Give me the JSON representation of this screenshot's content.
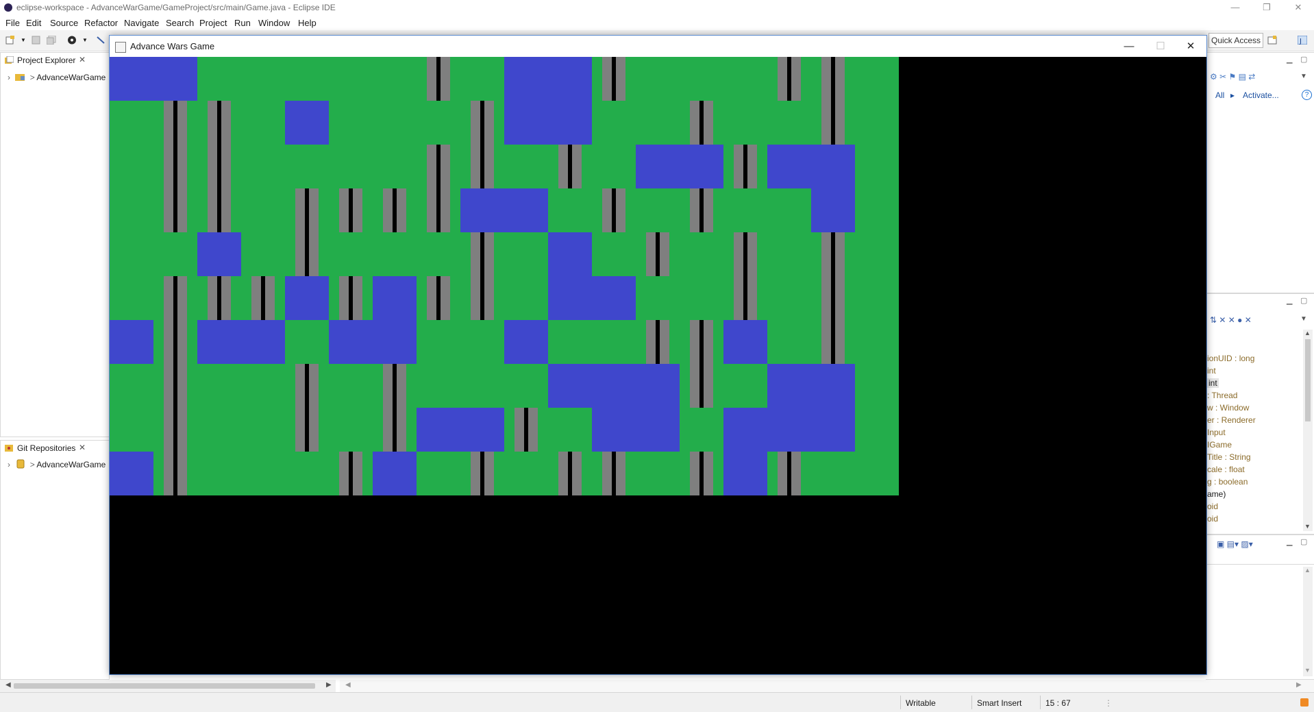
{
  "ide": {
    "window_title": "eclipse-workspace - AdvanceWarGame/GameProject/src/main/Game.java - Eclipse IDE",
    "window_controls": {
      "minimize": "—",
      "restore": "❐",
      "close": "✕"
    },
    "menu": [
      "File",
      "Edit",
      "Source",
      "Refactor",
      "Navigate",
      "Search",
      "Project",
      "Run",
      "Window",
      "Help"
    ],
    "quick_access": "Quick Access",
    "project_explorer": {
      "title": "Project Explorer",
      "close_glyph": "✕",
      "items": [
        {
          "label": "AdvanceWarGame",
          "prefix": ">"
        }
      ]
    },
    "git_repositories": {
      "title": "Git Repositories",
      "close_glyph": "✕",
      "items": [
        {
          "label": "AdvanceWarGame",
          "prefix": ">"
        }
      ]
    },
    "tasks_toolbar": {
      "all": "All",
      "activate": "Activate..."
    },
    "outline": {
      "items": [
        {
          "name": "ionUID",
          "type": " : long"
        },
        {
          "name": "int",
          "type": ""
        },
        {
          "name": "int",
          "type": "",
          "selected": true
        },
        {
          "name": "",
          "type": ": Thread"
        },
        {
          "name": "w",
          "type": " : Window"
        },
        {
          "name": "er",
          "type": " : Renderer"
        },
        {
          "name": "Input",
          "type": ""
        },
        {
          "name": "IGame",
          "type": ""
        },
        {
          "name": "Title",
          "type": " : String"
        },
        {
          "name": "cale",
          "type": " : float"
        },
        {
          "name": "g",
          "type": " : boolean"
        },
        {
          "name": "ame)",
          "type": ""
        },
        {
          "name": "oid",
          "type": ""
        },
        {
          "name": "oid",
          "type": ""
        }
      ]
    },
    "status": {
      "writable": "Writable",
      "insert_mode": "Smart Insert",
      "position": "15 : 67"
    }
  },
  "game_window": {
    "title": "Advance Wars Game",
    "controls": {
      "minimize": "—",
      "maximize": "☐",
      "close": "✕"
    }
  },
  "map": {
    "legend": {
      "G": "grass",
      "W": "water",
      "R": "road"
    },
    "colors": {
      "grass": "#23ad4b",
      "water": "#3f47cc",
      "road": "#7f7f7f",
      "road_line": "#000000",
      "background": "#000000"
    },
    "rows": [
      "WWGGGGGRGWWRGGGRRG",
      "GRRGWGGGRWWGGRGGRG",
      "GRRGGGGRRGRGWWRWWG",
      "GRRGRRRRWWGRGRGGWG",
      "GGWGRGGGRGWGRGRGRG",
      "GRRRWRWRRGWWGGRGRG",
      "WRWWGWWGGWGGRRWGRG",
      "GRGGRGRGGGWWWRGWWG",
      "GRGGRGRWWRGWWGWWWG",
      "WRGGGRWGRGRRGRWRGG"
    ]
  }
}
